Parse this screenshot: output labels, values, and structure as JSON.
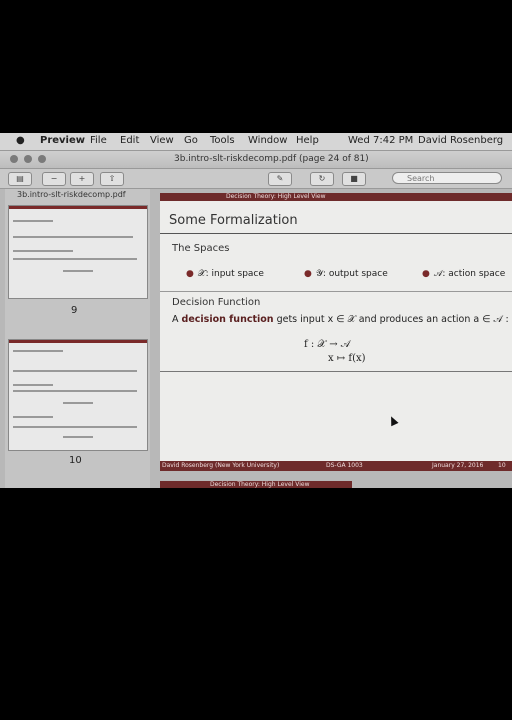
{
  "menubar": {
    "apple": "",
    "app_name": "Preview",
    "items": [
      "File",
      "Edit",
      "View",
      "Go",
      "Tools",
      "Window",
      "Help"
    ],
    "clock": "Wed 7:42 PM",
    "user": "David Rosenberg"
  },
  "window": {
    "title": "3b.intro-slt-riskdecomp.pdf (page 24 of 81)"
  },
  "toolbar": {
    "search_placeholder": "Search"
  },
  "sidebar": {
    "file_name": "3b.intro-slt-riskdecomp.pdf",
    "page_numbers": [
      "9",
      "10"
    ]
  },
  "slide": {
    "header_strip": "Decision Theory: High Level View",
    "title": "Some Formalization",
    "section_spaces": "The Spaces",
    "bullets": [
      {
        "symbol": "𝒳",
        "text": ": input space"
      },
      {
        "symbol": "𝒴",
        "text": ": output space"
      },
      {
        "symbol": "𝒜",
        "text": ": action space"
      }
    ],
    "section_decision": "Decision Function",
    "definition_prefix": "A ",
    "definition_term": "decision function",
    "definition_rest": " gets input x ∈ 𝒳 and produces an action a ∈ 𝒜 :",
    "math_line1": "f :  𝒳   →   𝒜",
    "math_line2": "x   ↦   f(x)",
    "footer_left": "David Rosenberg (New York University)",
    "footer_mid": "DS-GA 1003",
    "footer_right": "January 27, 2016",
    "footer_page": "10"
  },
  "next_slide_strip": "Decision Theory: High Level View",
  "colors": {
    "beamer_accent": "#6e2b2b",
    "menubar_bg": "#d6d6d6",
    "page_bg": "#ededeb"
  }
}
